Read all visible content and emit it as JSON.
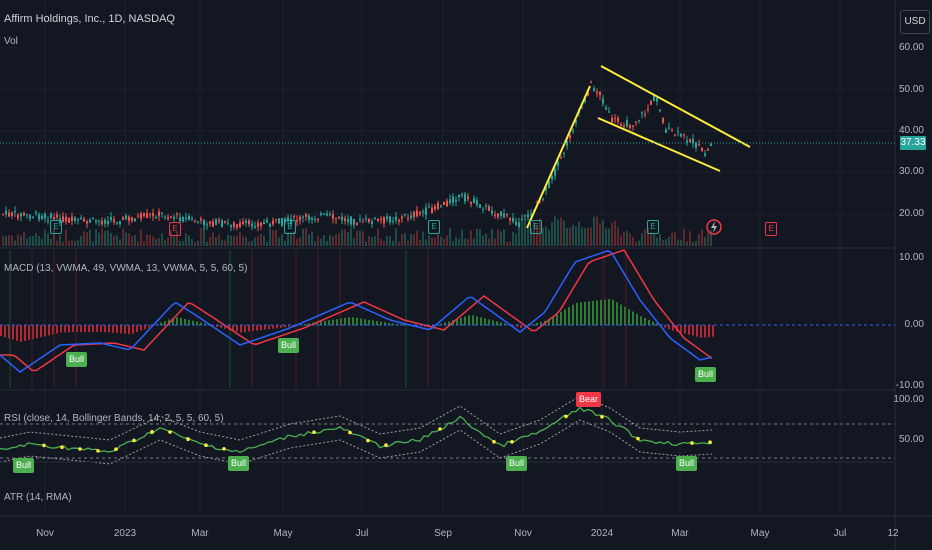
{
  "header": {
    "title": "Affirm Holdings, Inc., 1D, NASDAQ",
    "volume_label": "Vol",
    "currency_button": "USD"
  },
  "price_axis": {
    "ticks": [
      "60.00",
      "50.00",
      "40.00",
      "30.00",
      "20.00"
    ],
    "last_price": "37.33"
  },
  "macd": {
    "label": "MACD (13, VWMA, 49, VWMA, 13, VWMA, 5, 5, 60, 5)",
    "ticks": [
      "10.00",
      "0.00",
      "-10.00"
    ]
  },
  "rsi": {
    "label": "RSI (close, 14, Bollinger Bands, 14, 2, 5, 5, 60, 5)",
    "ticks": [
      "100.00",
      "50.00"
    ]
  },
  "atr": {
    "label": "ATR (14, RMA)"
  },
  "time_axis": {
    "labels": [
      "Nov",
      "2023",
      "Mar",
      "May",
      "Jul",
      "Sep",
      "Nov",
      "2024",
      "Mar",
      "May",
      "Jul",
      "12"
    ]
  },
  "badges": {
    "macd_bull": [
      "Bull",
      "Bull",
      "Bull"
    ],
    "rsi_bull": [
      "Bull",
      "Bull",
      "Bull",
      "Bull"
    ],
    "rsi_bear": "Bear"
  },
  "events": {
    "e": "E",
    "r": "E"
  },
  "colors": {
    "up": "#26a69a",
    "down": "#ef5350",
    "trend": "#ffeb3b",
    "macd": "#2962ff",
    "signal": "#f23645",
    "bg": "#131722"
  }
}
